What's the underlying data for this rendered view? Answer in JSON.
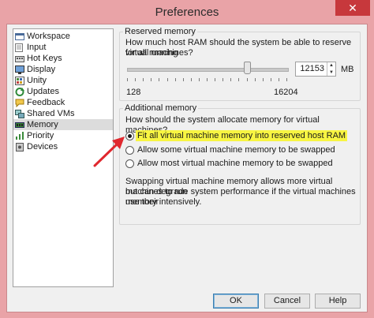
{
  "window": {
    "title": "Preferences",
    "close_glyph": "✕"
  },
  "sidebar": {
    "items": [
      {
        "label": "Workspace",
        "icon": "workspace-icon",
        "selected": false
      },
      {
        "label": "Input",
        "icon": "input-icon",
        "selected": false
      },
      {
        "label": "Hot Keys",
        "icon": "hotkeys-icon",
        "selected": false
      },
      {
        "label": "Display",
        "icon": "display-icon",
        "selected": false
      },
      {
        "label": "Unity",
        "icon": "unity-icon",
        "selected": false
      },
      {
        "label": "Updates",
        "icon": "updates-icon",
        "selected": false
      },
      {
        "label": "Feedback",
        "icon": "feedback-icon",
        "selected": false
      },
      {
        "label": "Shared VMs",
        "icon": "shared-vms-icon",
        "selected": false
      },
      {
        "label": "Memory",
        "icon": "memory-icon",
        "selected": true
      },
      {
        "label": "Priority",
        "icon": "priority-icon",
        "selected": false
      },
      {
        "label": "Devices",
        "icon": "devices-icon",
        "selected": false
      }
    ]
  },
  "reserved": {
    "title": "Reserved memory",
    "question_line1": "How much host RAM should the system be able to reserve for all running",
    "question_line2": "virtual machines?",
    "slider_min_label": "128",
    "slider_max_label": "16204",
    "slider_value": 12153,
    "slider_min": 128,
    "slider_max": 16204,
    "value_text": "12153",
    "unit": "MB"
  },
  "additional": {
    "title": "Additional memory",
    "question": "How should the system allocate memory for virtual machines?",
    "options": [
      {
        "label": "Fit all virtual machine memory into reserved host RAM",
        "checked": true
      },
      {
        "label": "Allow some virtual machine memory to be swapped",
        "checked": false
      },
      {
        "label": "Allow most virtual machine memory to be swapped",
        "checked": false
      }
    ],
    "description_line1": "Swapping virtual machine memory allows more virtual machines to run",
    "description_line2": "but can degrade system performance if the virtual machines use their",
    "description_line3": "memory intensively."
  },
  "buttons": {
    "ok": "OK",
    "cancel": "Cancel",
    "help": "Help"
  },
  "colors": {
    "highlight": "#f8f542",
    "annotation_arrow": "#e0282e",
    "title_bar": "#e9a3a7"
  }
}
